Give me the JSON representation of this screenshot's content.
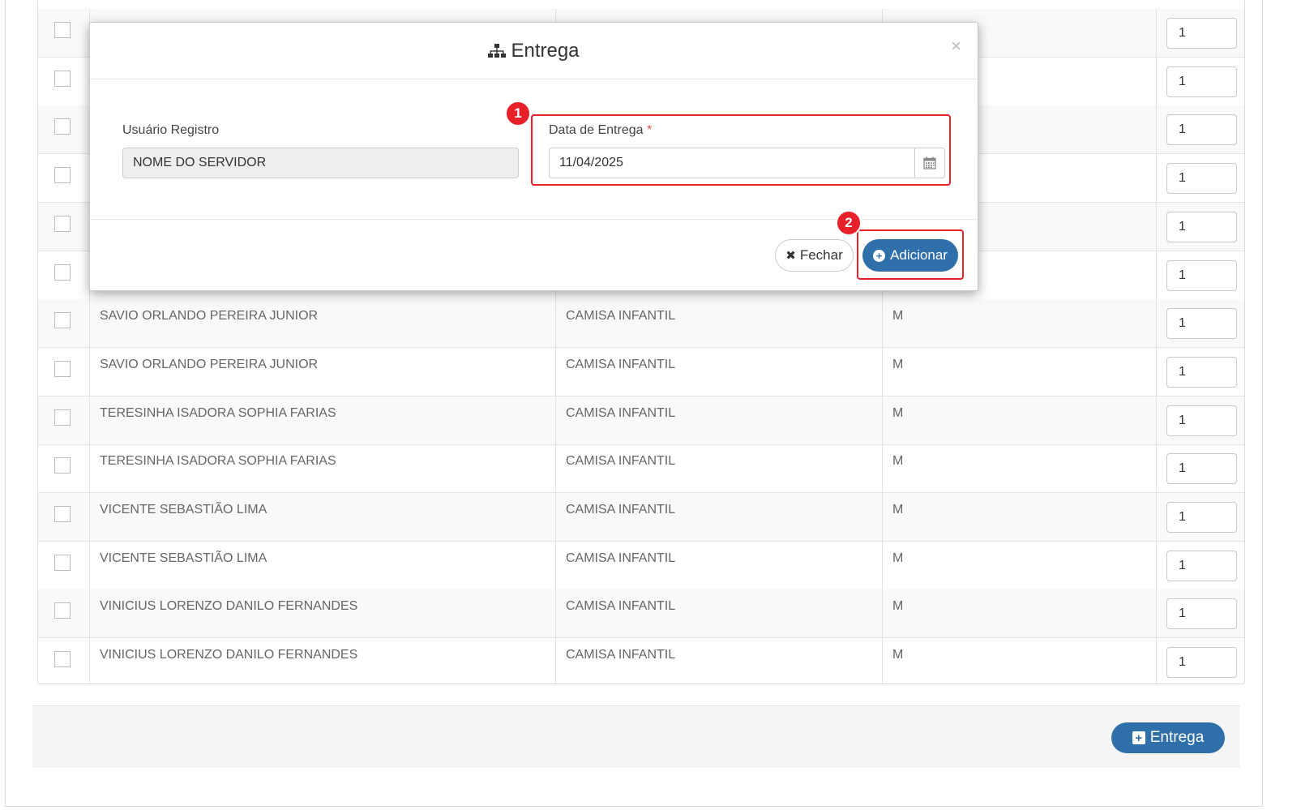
{
  "table": {
    "rows": [
      {
        "name": "",
        "item": "",
        "size": "",
        "qty": "1"
      },
      {
        "name": "",
        "item": "",
        "size": "",
        "qty": "1"
      },
      {
        "name": "",
        "item": "",
        "size": "",
        "qty": "1"
      },
      {
        "name": "",
        "item": "",
        "size": "",
        "qty": "1"
      },
      {
        "name": "",
        "item": "",
        "size": "",
        "qty": "1"
      },
      {
        "name": "",
        "item": "",
        "size": "",
        "qty": "1"
      },
      {
        "name": "SAVIO ORLANDO PEREIRA JUNIOR",
        "item": "CAMISA INFANTIL",
        "size": "M",
        "qty": "1"
      },
      {
        "name": "SAVIO ORLANDO PEREIRA JUNIOR",
        "item": "CAMISA INFANTIL",
        "size": "M",
        "qty": "1"
      },
      {
        "name": "TERESINHA ISADORA SOPHIA FARIAS",
        "item": "CAMISA INFANTIL",
        "size": "M",
        "qty": "1"
      },
      {
        "name": "TERESINHA ISADORA SOPHIA FARIAS",
        "item": "CAMISA INFANTIL",
        "size": "M",
        "qty": "1"
      },
      {
        "name": "VICENTE SEBASTIÃO LIMA",
        "item": "CAMISA INFANTIL",
        "size": "M",
        "qty": "1"
      },
      {
        "name": "VICENTE SEBASTIÃO LIMA",
        "item": "CAMISA INFANTIL",
        "size": "M",
        "qty": "1"
      },
      {
        "name": "VINICIUS LORENZO DANILO FERNANDES",
        "item": "CAMISA INFANTIL",
        "size": "M",
        "qty": "1"
      },
      {
        "name": "VINICIUS LORENZO DANILO FERNANDES",
        "item": "CAMISA INFANTIL",
        "size": "M",
        "qty": "1"
      }
    ]
  },
  "footer": {
    "entrega_button": "Entrega",
    "entrega_icon": "plus-square-icon"
  },
  "modal": {
    "title": "Entrega",
    "title_icon": "sitemap-icon",
    "close_label": "×",
    "usuario_label": "Usuário Registro",
    "usuario_value": "NOME DO SERVIDOR",
    "data_label": "Data de Entrega",
    "required_mark": "*",
    "data_value": "11/04/2025",
    "calendar_icon": "calendar-icon",
    "fechar_label": "Fechar",
    "adicionar_label": "Adicionar"
  },
  "annotations": {
    "badge_1": "1",
    "badge_2": "2",
    "highlight_color": "#e8202a"
  },
  "colors": {
    "primary": "#2f6faa"
  }
}
